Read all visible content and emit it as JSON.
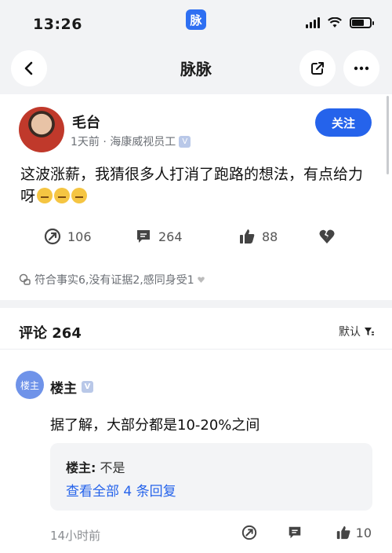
{
  "status_bar": {
    "time": "13:26",
    "app_badge": "脉"
  },
  "navbar": {
    "title": "脉脉"
  },
  "post": {
    "author": "毛台",
    "meta": "1天前 · 海康威视员工",
    "follow_label": "关注",
    "text": "这波涨薪，我猜很多人打消了跑路的想法，有点给力呀",
    "repost_count": "106",
    "comment_count": "264",
    "like_count": "88",
    "reactions": "符合事实6,没有证据2,感同身受1"
  },
  "comments": {
    "header": "评论 264",
    "sort_label": "默认",
    "items": [
      {
        "avatar_label": "楼主",
        "name": "楼主",
        "text": "据了解，大部分都是10-20%之间",
        "reply_author": "楼主:",
        "reply_text": "不是",
        "reply_more": "查看全部 4 条回复",
        "time": "14小时前",
        "like_count": "10"
      }
    ]
  },
  "colors": {
    "accent": "#2563eb",
    "background": "#f2f3f5",
    "badge": "#6f93e9"
  }
}
